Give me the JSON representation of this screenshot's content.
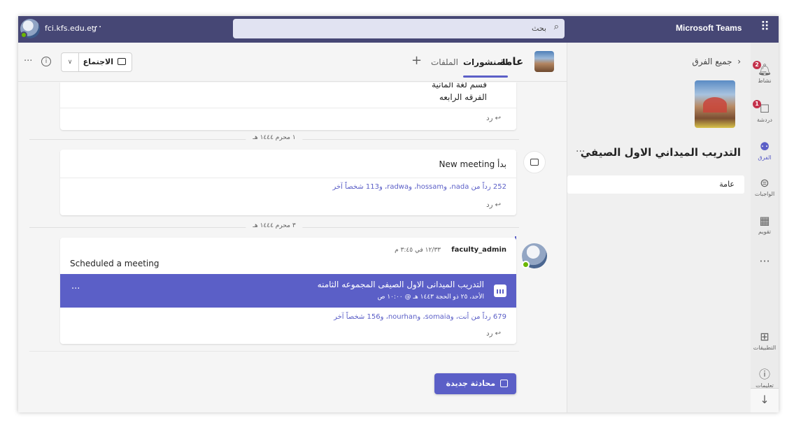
{
  "titlebar": {
    "org": "fci.kfs.edu.eg",
    "more": "···",
    "search_placeholder": "بحث",
    "app_name": "Microsoft Teams"
  },
  "rail": {
    "items": [
      {
        "label": "نشاط",
        "icon": "bell-icon",
        "badge": "2"
      },
      {
        "label": "دردشة",
        "icon": "chat-icon",
        "badge": "1"
      },
      {
        "label": "الفرق",
        "icon": "teams-icon"
      },
      {
        "label": "الواجبات",
        "icon": "assignments-icon"
      },
      {
        "label": "تقويم",
        "icon": "calendar-icon"
      },
      {
        "label": "···",
        "icon": "more-icon"
      },
      {
        "label": "التطبيقات",
        "icon": "apps-icon"
      },
      {
        "label": "تعليمات",
        "icon": "help-icon"
      }
    ]
  },
  "teams_panel": {
    "back_label": "جميع الفرق",
    "team_name": "التدريب الميداني الاول الصيفي",
    "more": "···",
    "channel": "عامة"
  },
  "channel_header": {
    "title": "عامة",
    "tab_posts": "المنشورات",
    "tab_files": "الملفات",
    "add": "+",
    "meet_label": "الاجتماع",
    "more": "···"
  },
  "feed": {
    "post1": {
      "line1": "قسم لغة المانية",
      "line2": "الفرقه الرابعه",
      "reply": "رد"
    },
    "date1": "١ محرم ١٤٤٤ هـ",
    "post2": {
      "text": "بدأ New meeting",
      "replies": "252 رداً من nada، وhossam، وradwa، و113 شخصاً آخر",
      "reply": "رد"
    },
    "date2": "٣ محرم ١٤٤٤ هـ",
    "post3": {
      "author": "faculty_admin",
      "time": "١٢/٣٣ في ٣:٤٥ م",
      "text": "Scheduled a meeting",
      "meeting_title": "التدريب الميدانى الاول الصيفى المجموعه الثامنه",
      "meeting_time": "الأحد، ٢٥ ذو الحجة ١٤٤٣ هـ @ ١٠:٠٠ ص",
      "meeting_more": "···",
      "replies": "679 رداً من أنت، وsomaia، وnourhan، و156 شخصاً آخر",
      "reply": "رد"
    },
    "new_conversation": "محادثة جديدة"
  },
  "colors": {
    "titlebar": "#464775",
    "accent": "#5b5fc7",
    "badge": "#c4314b",
    "presence": "#6bb700"
  }
}
